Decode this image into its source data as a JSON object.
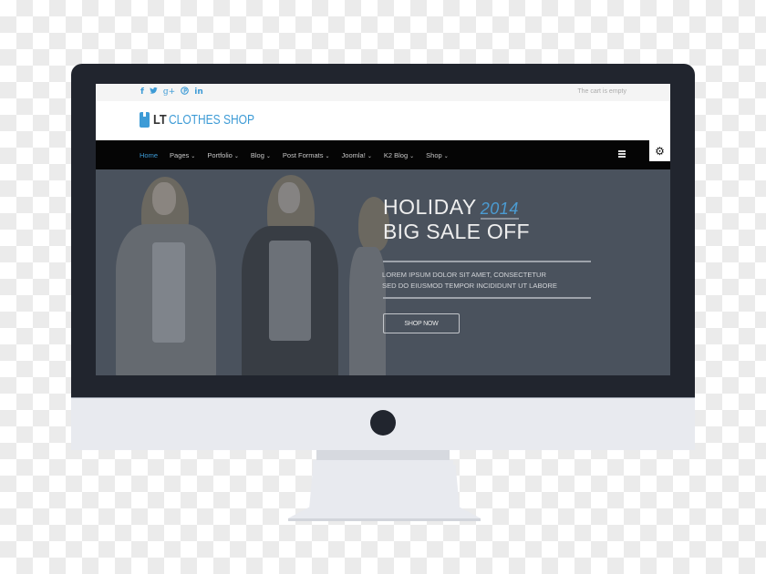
{
  "colors": {
    "accent": "#3d9bd6",
    "navbar_bg": "#050505",
    "hero_bg": "#4a525d",
    "monitor_frame": "#21252e",
    "monitor_chin": "#e8eaef"
  },
  "topbar": {
    "social_icons": [
      {
        "name": "facebook-icon",
        "glyph": "f"
      },
      {
        "name": "twitter-icon",
        "glyph": "🐦"
      },
      {
        "name": "google-plus-icon",
        "glyph": "g+"
      },
      {
        "name": "pinterest-icon",
        "glyph": "℗"
      },
      {
        "name": "linkedin-icon",
        "glyph": "in"
      }
    ],
    "cart_status": "The cart is empty"
  },
  "header": {
    "logo_icon": "shopping-bag-icon",
    "logo_prefix": "LT",
    "logo_name": "CLOTHES SHOP"
  },
  "navbar": {
    "items": [
      {
        "label": "Home",
        "active": true,
        "dropdown": false
      },
      {
        "label": "Pages",
        "active": false,
        "dropdown": true
      },
      {
        "label": "Portfolio",
        "active": false,
        "dropdown": true
      },
      {
        "label": "Blog",
        "active": false,
        "dropdown": true
      },
      {
        "label": "Post Formats",
        "active": false,
        "dropdown": true
      },
      {
        "label": "Joomla!",
        "active": false,
        "dropdown": true
      },
      {
        "label": "K2 Blog",
        "active": false,
        "dropdown": true
      },
      {
        "label": "Shop",
        "active": false,
        "dropdown": true
      }
    ],
    "chevron_glyph": "⌄",
    "menu_icon": "hamburger-icon",
    "settings_icon": "gear-icon",
    "settings_glyph": "⚙"
  },
  "hero": {
    "title_line1": "HOLIDAY",
    "title_year": "2014",
    "title_line2": "BIG SALE OFF",
    "body_line1": "LOREM IPSUM DOLOR SIT AMET, CONSECTETUR",
    "body_line2": "SED DO EIUSMOD TEMPOR INCIDIDUNT UT LABORE",
    "cta_label": "SHOP NOW"
  }
}
